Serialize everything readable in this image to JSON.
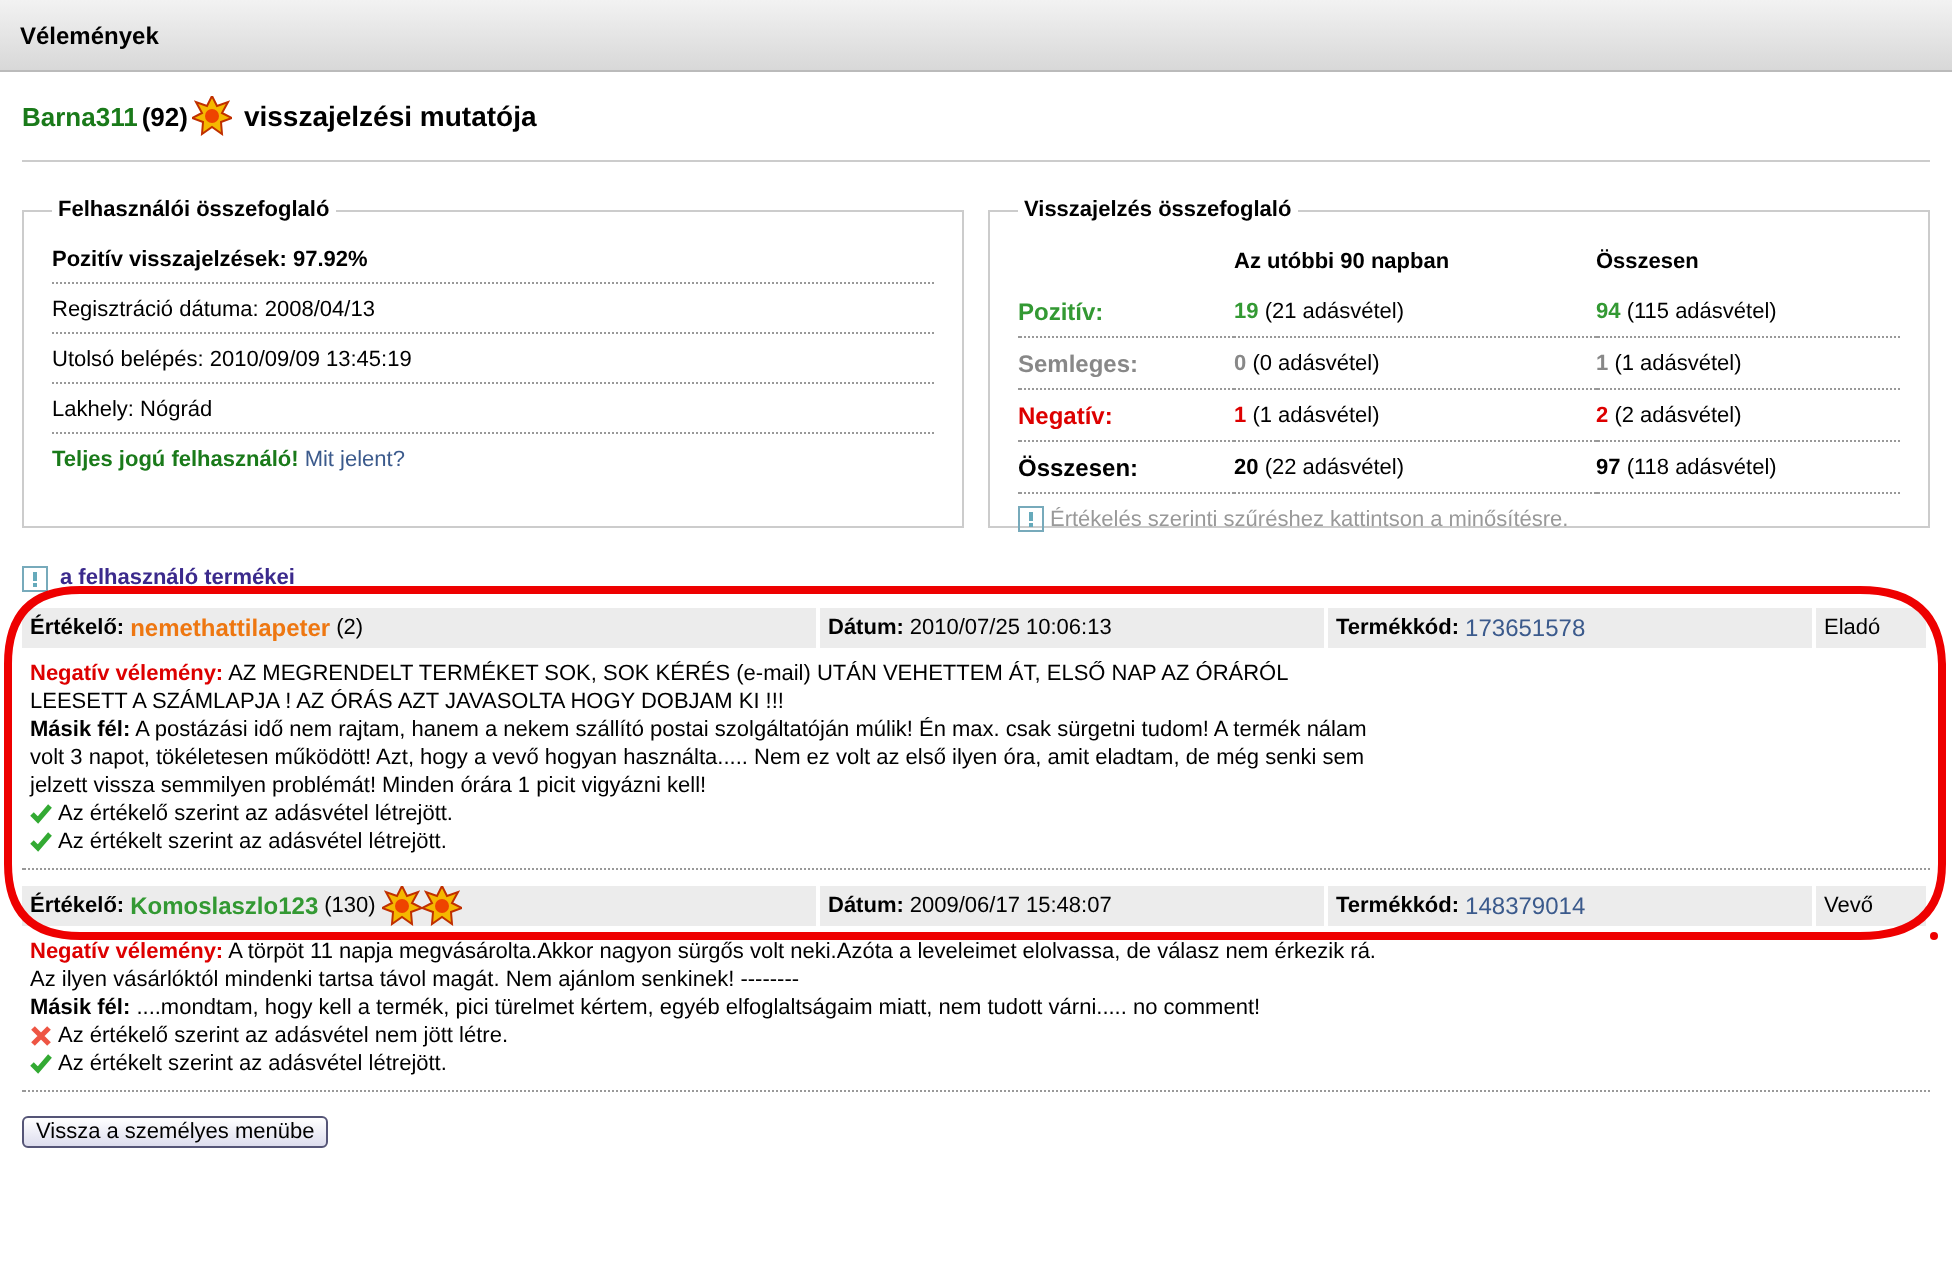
{
  "window": {
    "title": "Vélemények"
  },
  "heading": {
    "user": "Barna311",
    "score": "(92)",
    "badges": [
      {
        "kind": "sun"
      }
    ],
    "text": "visszajelzési mutatója"
  },
  "user_summary": {
    "title": "Felhasználói összefoglaló",
    "rows": [
      {
        "kind": "bold",
        "text": "Pozitív visszajelzések: 97.92%"
      },
      {
        "kind": "plain",
        "text": "Regisztráció dátuma: 2008/04/13"
      },
      {
        "kind": "plain",
        "text": "Utolsó belépés: 2010/09/09 13:45:19"
      },
      {
        "kind": "plain",
        "text": "Lakhely: Nógrád"
      }
    ],
    "status": "Teljes jogú felhasználó!",
    "status_link": "Mit jelent?"
  },
  "feedback_summary": {
    "title": "Visszajelzés összefoglaló",
    "columns": [
      "Az utóbbi 90 napban",
      "Összesen"
    ],
    "rows": [
      {
        "label": "Pozitív:",
        "color": "#339933",
        "cells": [
          {
            "count": "19",
            "detail": "(21 adásvétel)"
          },
          {
            "count": "94",
            "detail": "(115 adásvétel)"
          }
        ]
      },
      {
        "label": "Semleges:",
        "color": "#888888",
        "cells": [
          {
            "count": "0",
            "detail": "(0 adásvétel)"
          },
          {
            "count": "1",
            "detail": "(1 adásvétel)"
          }
        ]
      },
      {
        "label": "Negatív:",
        "color": "#dd0000",
        "cells": [
          {
            "count": "1",
            "detail": "(1 adásvétel)"
          },
          {
            "count": "2",
            "detail": "(2 adásvétel)"
          }
        ]
      },
      {
        "label": "Összesen:",
        "color": "#000000",
        "cells": [
          {
            "count": "20",
            "detail": "(22 adásvétel)"
          },
          {
            "count": "97",
            "detail": "(118 adásvétel)"
          }
        ]
      }
    ],
    "hint": "Értékelés szerinti szűréshez kattintson a minősítésre."
  },
  "products_link": "a felhasználó termékei",
  "reviews": [
    {
      "rater_label": "Értékelő:",
      "rater": "nemethattilapeter",
      "color": "#ee7711",
      "score": "(2)",
      "date_label": "Dátum:",
      "date": "2010/07/25 10:06:13",
      "code_label": "Termékkód:",
      "code": "173651578",
      "role": "Eladó",
      "review_label": "Negatív vélemény:",
      "review": "AZ MEGRENDELT TERMÉKET SOK, SOK KÉRÉS (e-mail) UTÁN VEHETTEM ÁT, ELSŐ NAP AZ ÓRÁRÓL LEESETT A SZÁMLAPJA ! AZ ÓRÁS AZT JAVASOLTA HOGY DOBJAM KI !!!",
      "reply_label": "Másik fél:",
      "reply": "A postázási idő nem rajtam, hanem a nekem szállító postai szolgáltatóján múlik! Én max. csak sürgetni tudom! A termék nálam volt 3 napot, tökéletesen működött! Azt, hogy a vevő hogyan használta..... Nem ez volt az első ilyen óra, amit eladtam, de még senki sem jelzett vissza semmilyen problémát! Minden órára 1 picit vigyázni kell!",
      "verdicts": [
        {
          "kind": "ok",
          "text": "Az értékelő szerint az adásvétel létrejött."
        },
        {
          "kind": "ok",
          "text": "Az értékelt szerint az adásvétel létrejött."
        }
      ]
    },
    {
      "rater_label": "Értékelő:",
      "rater": "Komoslaszlo123",
      "color": "#339933",
      "score": "(130)",
      "badges": [
        {
          "kind": "sun"
        },
        {
          "kind": "sun"
        }
      ],
      "date_label": "Dátum:",
      "date": "2009/06/17 15:48:07",
      "code_label": "Termékkód:",
      "code": "148379014",
      "role": "Vevő",
      "review_label": "Negatív vélemény:",
      "review": "A törpöt 11 napja megvásárolta.Akkor nagyon sürgős volt neki.Azóta a leveleimet elolvassa, de válasz nem érkezik rá. Az ilyen vásárlóktól mindenki tartsa távol magát. Nem ajánlom senkinek! --------",
      "reply_label": "Másik fél:",
      "reply": "....mondtam, hogy kell a termék, pici türelmet kértem, egyéb elfoglaltságaim miatt, nem tudott várni..... no comment!",
      "verdicts": [
        {
          "kind": "fail",
          "text": "Az értékelő szerint az adásvétel nem jött létre."
        },
        {
          "kind": "ok",
          "text": "Az értékelt szerint az adásvétel létrejött."
        }
      ]
    }
  ],
  "back_button": "Vissza a személyes menübe"
}
